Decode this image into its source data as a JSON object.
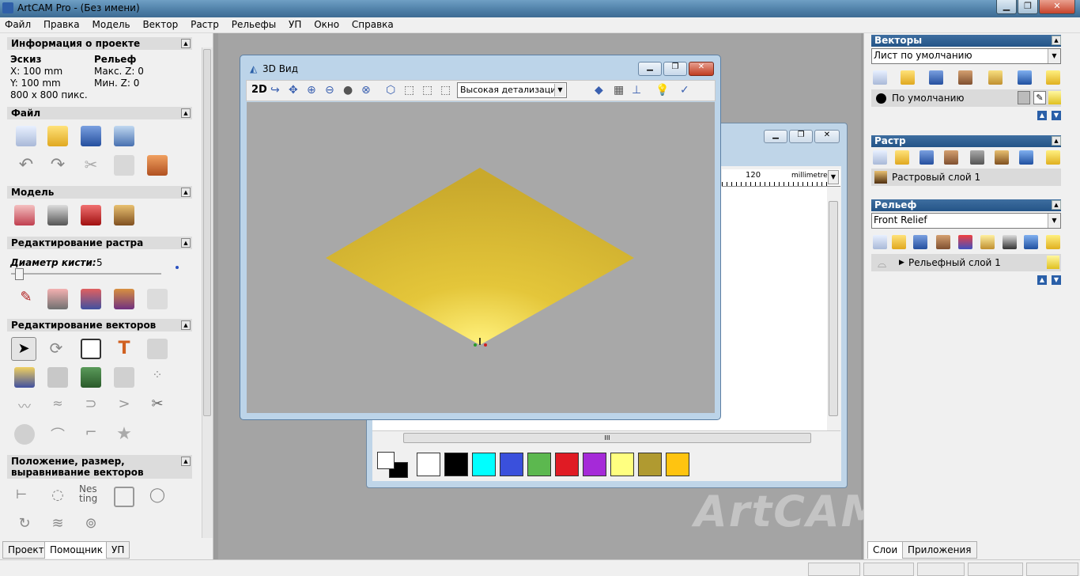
{
  "app": {
    "title": "ArtCAM Pro - (Без имени)"
  },
  "menu": [
    "Файл",
    "Правка",
    "Модель",
    "Вектор",
    "Растр",
    "Рельефы",
    "УП",
    "Окно",
    "Справка"
  ],
  "project_info": {
    "header": "Информация о проекте",
    "sketch_label": "Эскиз",
    "x": "X: 100 mm",
    "y": "Y: 100 mm",
    "pixels": "800 x 800 пикс.",
    "relief_label": "Рельеф",
    "max_z": "Макс. Z: 0",
    "min_z": "Мин. Z: 0"
  },
  "sections": {
    "file": "Файл",
    "model": "Модель",
    "raster_edit": "Редактирование растра",
    "brush_label": "Диаметр кисти:",
    "brush_value": "5",
    "vector_edit": "Редактирование векторов",
    "position": "Положение, размер, выравнивание векторов",
    "nesting": "Nes ting"
  },
  "left_tabs": [
    "Проект",
    "Помощник",
    "УП"
  ],
  "window3d": {
    "title": "3D Вид",
    "mode_2d": "2D",
    "detail_select": "Высокая детализация"
  },
  "window2d": {
    "ruler_value": "120",
    "ruler_unit": "millimetres",
    "scroll_grip": "III"
  },
  "palette_colors": [
    "#ffffff",
    "#000000",
    "#00ffff",
    "#3a50dc",
    "#5cb84f",
    "#e01b24",
    "#a52ad8",
    "#ffff80",
    "#b09a30",
    "#ffc410"
  ],
  "watermark": "ArtCAM",
  "right": {
    "vectors_header": "Векторы",
    "vectors_sheet": "Лист по умолчанию",
    "vectors_layer": "По умолчанию",
    "raster_header": "Растр",
    "raster_layer": "Растровый слой 1",
    "relief_header": "Рельеф",
    "relief_combo": "Front Relief",
    "relief_layer": "Рельефный слой 1"
  },
  "right_tabs": [
    "Слои",
    "Приложения"
  ]
}
